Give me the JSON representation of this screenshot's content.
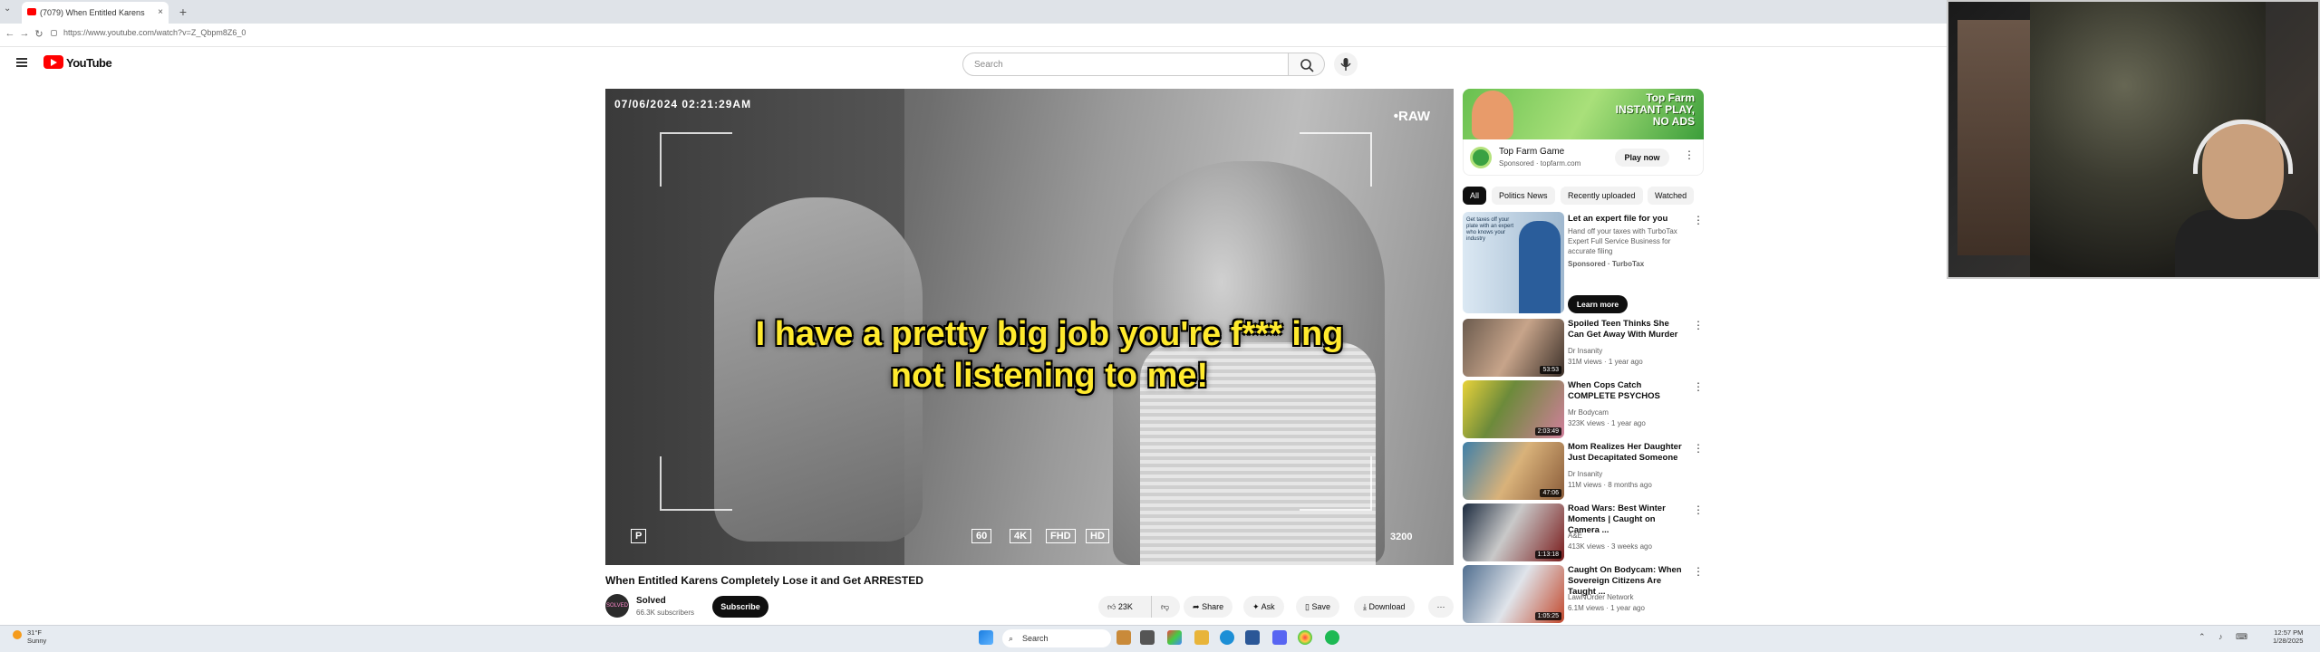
{
  "browser": {
    "tab_title": "(7079) When Entitled Karens",
    "tab_close": "×",
    "new_tab": "+",
    "url": "https://www.youtube.com/watch?v=Z_Qbpm8Z6_0",
    "nav_back": "←",
    "nav_forward": "→",
    "nav_reload": "↻"
  },
  "header": {
    "logo_text": "YouTube",
    "search_placeholder": "Search"
  },
  "video": {
    "timestamp": "07/06/2024 02:21:29AM",
    "raw_label": "•RAW",
    "caption": "I have a pretty big job you're f*** ing not listening to me!",
    "badges": [
      "60",
      "4K",
      "FHD",
      "HD"
    ],
    "iso": "3200",
    "p_label": "P"
  },
  "below": {
    "title": "When Entitled Karens Completely Lose it and Get ARRESTED",
    "channel": "Solved",
    "subscribers": "66.3K subscribers",
    "subscribe": "Subscribe",
    "likes": "23K",
    "share": "Share",
    "ask": "Ask",
    "save": "Save",
    "download": "Download",
    "more": "···"
  },
  "ad": {
    "banner_text": "INSTANT PLAY, NO ADS",
    "banner_top": "Top Farm",
    "title": "Top Farm Game",
    "sponsored": "Sponsored · topfarm.com",
    "play": "Play now",
    "more": "⋮"
  },
  "chips": [
    "All",
    "Politics News",
    "Recently uploaded",
    "Watched"
  ],
  "promo": {
    "title": "Let an expert file for you",
    "desc": "Hand off your taxes with TurboTax Expert Full Service Business for accurate filing",
    "sponsored": "Sponsored · TurboTax",
    "cta": "Learn more",
    "thumb_text": "Get taxes off your plate with an expert who knows your industry"
  },
  "videos": [
    {
      "title": "Spoiled Teen Thinks She Can Get Away With Murder",
      "channel": "Dr Insanity",
      "meta": "31M views · 1 year ago",
      "duration": "53:53"
    },
    {
      "title": "When Cops Catch COMPLETE PSYCHOS",
      "channel": "Mr Bodycam",
      "meta": "323K views · 1 year ago",
      "duration": "2:03:49"
    },
    {
      "title": "Mom Realizes Her Daughter Just Decapitated Someone",
      "channel": "Dr Insanity",
      "meta": "11M views · 8 months ago",
      "duration": "47:06"
    },
    {
      "title": "Road Wars: Best Winter Moments | Caught on Camera ...",
      "channel": "A&E",
      "meta": "413K views · 3 weeks ago",
      "duration": "1:13:18"
    },
    {
      "title": "Caught On Bodycam: When Sovereign Citizens Are Taught ...",
      "channel": "LawNOrder Network",
      "meta": "6.1M views · 1 year ago",
      "duration": "1:05:25"
    }
  ],
  "taskbar": {
    "weather_temp": "31°F",
    "weather_desc": "Sunny",
    "search": "Search",
    "time": "12:57 PM",
    "date": "1/28/2025"
  },
  "colors": {
    "accent": "#ff0000",
    "caption": "#ffea2e",
    "dark_button": "#0f0f0f"
  }
}
